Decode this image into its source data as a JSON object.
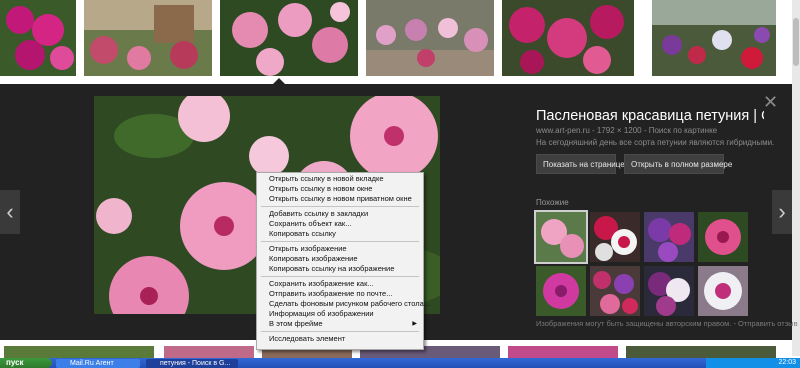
{
  "preview": {
    "title": "Пасленовая красавица петуния | О...",
    "source": "www.art-pen.ru - 1792 × 1200 - Поиск по картинке",
    "description": "На сегодняшний день все сорта петунии являются гибридными.",
    "visit_button": "Показать на странице",
    "full_size_button": "Открыть в полном размере",
    "similar_label": "Похожие",
    "copyright": "Изображения могут быть защищены авторским правом. - Отправить отзыв",
    "close": "✕"
  },
  "nav": {
    "prev": "‹",
    "next": "›"
  },
  "context_menu": {
    "groups": [
      [
        "Открыть ссылку в новой вкладке",
        "Открыть ссылку в новом окне",
        "Открыть ссылку в новом приватном окне"
      ],
      [
        "Добавить ссылку в закладки",
        "Сохранить объект как...",
        "Копировать ссылку"
      ],
      [
        "Открыть изображение",
        "Копировать изображение",
        "Копировать ссылку на изображение"
      ],
      [
        "Сохранить изображение как...",
        "Отправить изображение по почте...",
        "Сделать фоновым рисунком рабочего стола...",
        "Информация об изображении",
        "В этом фрейме"
      ],
      [
        "Исследовать элемент"
      ]
    ]
  },
  "taskbar": {
    "start": "пуск",
    "tasks": [
      "Mail.Ru Агент",
      "петуния - Поиск в G..."
    ],
    "clock": "22:03"
  },
  "colors": {
    "panel": "#222222",
    "menu_bg": "#f2f2f2",
    "taskbar": "#2450b8",
    "button": "#3f3f3f"
  }
}
